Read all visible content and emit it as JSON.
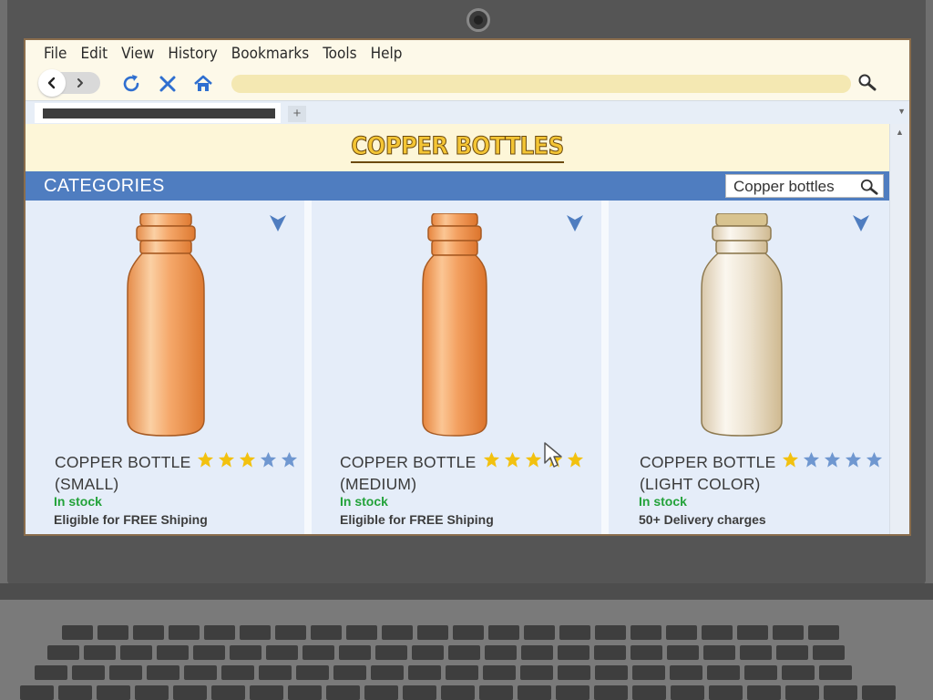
{
  "browser": {
    "menu": [
      "File",
      "Edit",
      "View",
      "History",
      "Bookmarks",
      "Tools",
      "Help"
    ],
    "new_tab_label": "+"
  },
  "site": {
    "title": "COPPER BOTTLES",
    "categories_label": "CATEGORIES",
    "search_value": "Copper bottles"
  },
  "products": [
    {
      "name_line1": "COPPER BOTTLE",
      "name_line2": "(SMALL)",
      "rating": 3,
      "max_rating": 5,
      "stock": "In stock",
      "shipping": "Eligible for FREE Shiping",
      "color": "copper"
    },
    {
      "name_line1": "COPPER BOTTLE",
      "name_line2": "(MEDIUM)",
      "rating": 5,
      "max_rating": 5,
      "stock": "In stock",
      "shipping": "Eligible for FREE Shiping",
      "color": "copper"
    },
    {
      "name_line1": "COPPER BOTTLE",
      "name_line2": "(LIGHT COLOR)",
      "rating": 1,
      "max_rating": 5,
      "stock": "In stock",
      "shipping": "50+ Delivery charges",
      "color": "light"
    }
  ],
  "colors": {
    "category_bar": "#4f7dc0",
    "star_filled": "#f2c10f",
    "star_empty": "#6f97d0",
    "in_stock": "#23a23a",
    "title_gold": "#f4c534"
  }
}
